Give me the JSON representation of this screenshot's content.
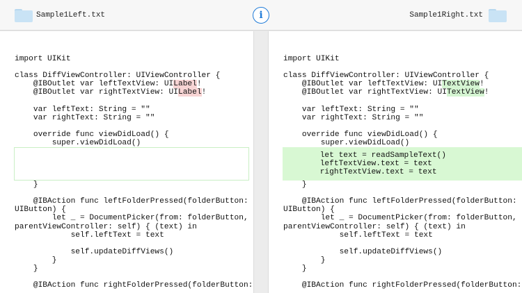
{
  "header": {
    "left_file": "Sample1Left.txt",
    "right_file": "Sample1Right.txt",
    "info_glyph": "i"
  },
  "colors": {
    "accent": "#1f7bd8",
    "removed_highlight": "#f7d4d4",
    "added_highlight": "#d5f5d2",
    "folder": "#c9e3f5"
  },
  "left": {
    "l1": "import UIKit",
    "l2": "class DiffViewController: UIViewController {",
    "l3a": "    @IBOutlet var leftTextView: UI",
    "l3b": "Label",
    "l3c": "!",
    "l4a": "    @IBOutlet var rightTextView: UI",
    "l4b": "Label",
    "l4c": "!",
    "l5": "    var leftText: String = \"\"",
    "l6": "    var rightText: String = \"\"",
    "l7": "    override func viewDidLoad() {",
    "l8": "        super.viewDidLoad()",
    "l9": "    }",
    "l10": "    @IBAction func leftFolderPressed(folderButton:",
    "l11": "UIButton) {",
    "l12": "        let _ = DocumentPicker(from: folderButton,",
    "l13": "parentViewController: self) { (text) in",
    "l14": "            self.leftText = text",
    "l15": "            self.updateDiffViews()",
    "l16": "        }",
    "l17": "    }",
    "l18": "    @IBAction func rightFolderPressed(folderButton:"
  },
  "right": {
    "l1": "import UIKit",
    "l2": "class DiffViewController: UIViewController {",
    "l3a": "    @IBOutlet var leftTextView: UI",
    "l3b": "TextView",
    "l3c": "!",
    "l4a": "    @IBOutlet var rightTextView: UI",
    "l4b": "TextView",
    "l4c": "!",
    "l5": "    var leftText: String = \"\"",
    "l6": "    var rightText: String = \"\"",
    "l7": "    override func viewDidLoad() {",
    "l8": "        super.viewDidLoad()",
    "a1": "        let text = readSampleText()",
    "a2": "        leftTextView.text = text",
    "a3": "        rightTextView.text = text",
    "l9": "    }",
    "l10": "    @IBAction func leftFolderPressed(folderButton:",
    "l11": "UIButton) {",
    "l12": "        let _ = DocumentPicker(from: folderButton,",
    "l13": "parentViewController: self) { (text) in",
    "l14": "            self.leftText = text",
    "l15": "            self.updateDiffViews()",
    "l16": "        }",
    "l17": "    }",
    "l18": "    @IBAction func rightFolderPressed(folderButton:"
  }
}
